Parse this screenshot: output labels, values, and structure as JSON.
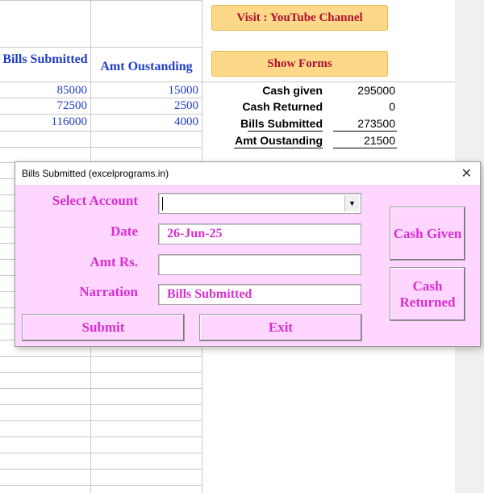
{
  "buttons": {
    "youtube": "Visit : YouTube Channel",
    "show_forms": "Show Forms"
  },
  "table": {
    "headers": [
      "Bills Submitted",
      "Amt Oustanding"
    ],
    "rows": [
      [
        "85000",
        "15000"
      ],
      [
        "72500",
        "2500"
      ],
      [
        "116000",
        "4000"
      ]
    ]
  },
  "summary": {
    "cash_given_label": "Cash given",
    "cash_given_value": "295000",
    "cash_returned_label": "Cash Returned",
    "cash_returned_value": "0",
    "bills_submitted_label": "Bills Submitted",
    "bills_submitted_value": "273500",
    "amt_outstanding_label": "Amt Oustanding",
    "amt_outstanding_value": "21500"
  },
  "dialog": {
    "title": "Bills Submitted (excelprograms.in)",
    "close_glyph": "✕",
    "select_account_label": "Select Account",
    "select_account_value": "",
    "dropdown_glyph": "▼",
    "date_label": "Date",
    "date_value": "26-Jun-25",
    "amt_label": "Amt Rs.",
    "amt_value": "",
    "narration_label": "Narration",
    "narration_value": "Bills Submitted",
    "submit_label": "Submit",
    "exit_label": "Exit",
    "cash_given_label": "Cash Given",
    "cash_returned_label": "Cash Returned"
  }
}
